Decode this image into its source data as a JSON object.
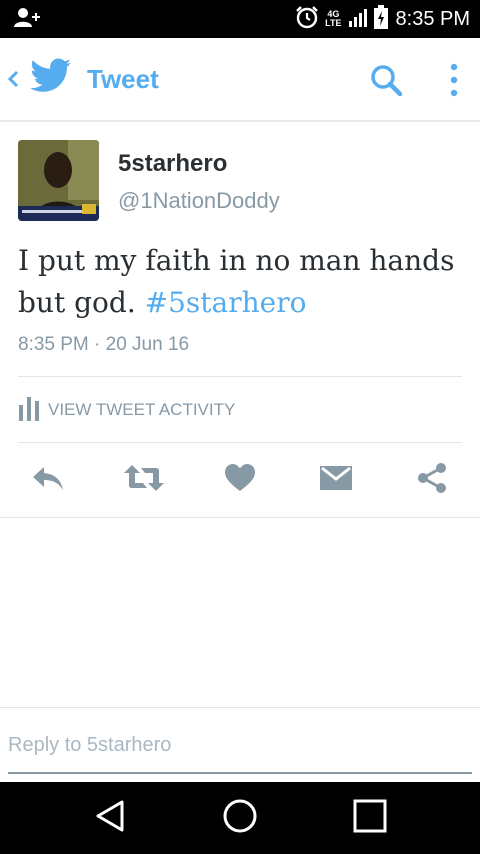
{
  "status_bar": {
    "time": "8:35 PM",
    "network_top": "4G",
    "network_bottom": "LTE",
    "icons": [
      "add-person-icon",
      "alarm-icon",
      "signal-icon",
      "battery-charging-icon"
    ]
  },
  "app_bar": {
    "title": "Tweet",
    "back_icon": "chevron-left-icon",
    "logo_icon": "twitter-bird-icon",
    "search_icon": "search-icon",
    "more_icon": "more-vertical-icon"
  },
  "tweet": {
    "display_name": "5starhero",
    "handle": "@1NationDoddy",
    "text_plain": "I put my faith in no man hands but god.",
    "hashtag": "#5starhero",
    "timestamp": "8:35 PM · 20 Jun 16"
  },
  "activity": {
    "label": "VIEW TWEET ACTIVITY",
    "icon": "bar-chart-icon"
  },
  "actions": [
    "reply-icon",
    "retweet-icon",
    "like-icon",
    "direct-message-icon",
    "share-icon"
  ],
  "reply": {
    "placeholder": "Reply to 5starhero"
  },
  "colors": {
    "accent": "#55acee",
    "text": "#292f33",
    "secondary": "#8899a6",
    "divider": "#e1e8ed"
  }
}
